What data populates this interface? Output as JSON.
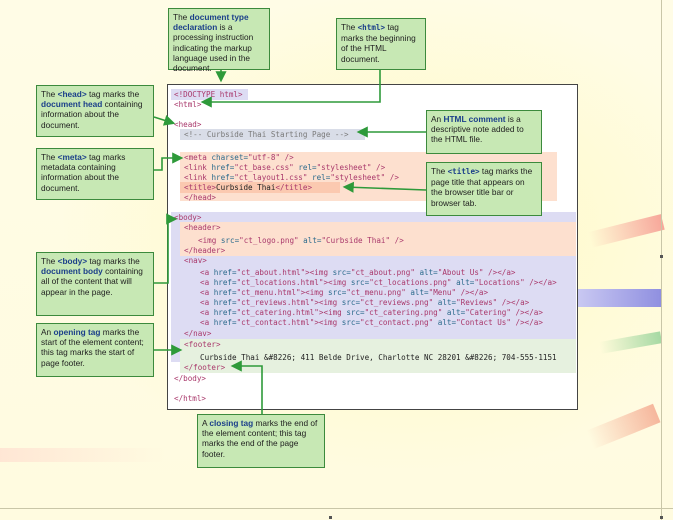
{
  "code_lines": [
    {
      "id": "doctype",
      "segments": [
        {
          "t": "<!DOCTYPE html>",
          "c": "tagc"
        }
      ]
    },
    {
      "id": "html_open",
      "segments": [
        {
          "t": "<html>",
          "c": "tagc"
        }
      ]
    },
    {
      "id": "head_open",
      "segments": [
        {
          "t": "<head>",
          "c": "tagc"
        }
      ]
    },
    {
      "id": "comment",
      "segments": [
        {
          "t": "<!-- Curbside Thai Starting Page -->",
          "c": "cmt"
        }
      ]
    },
    {
      "id": "meta",
      "segments": [
        {
          "t": "<meta ",
          "c": "tagc"
        },
        {
          "t": "charset=",
          "c": "attr"
        },
        {
          "t": "\"utf-8\"",
          "c": "val"
        },
        {
          "t": " />",
          "c": "tagc"
        }
      ]
    },
    {
      "id": "link1",
      "segments": [
        {
          "t": "<link ",
          "c": "tagc"
        },
        {
          "t": "href=",
          "c": "attr"
        },
        {
          "t": "\"ct_base.css\" ",
          "c": "val"
        },
        {
          "t": "rel=",
          "c": "attr"
        },
        {
          "t": "\"stylesheet\"",
          "c": "val"
        },
        {
          "t": " />",
          "c": "tagc"
        }
      ]
    },
    {
      "id": "link2",
      "segments": [
        {
          "t": "<link ",
          "c": "tagc"
        },
        {
          "t": "href=",
          "c": "attr"
        },
        {
          "t": "\"ct_layout1.css\" ",
          "c": "val"
        },
        {
          "t": "rel=",
          "c": "attr"
        },
        {
          "t": "\"stylesheet\"",
          "c": "val"
        },
        {
          "t": " />",
          "c": "tagc"
        }
      ]
    },
    {
      "id": "title",
      "segments": [
        {
          "t": "<title>",
          "c": "tagc"
        },
        {
          "t": "Curbside Thai",
          "c": ""
        },
        {
          "t": "</title>",
          "c": "tagc"
        }
      ]
    },
    {
      "id": "head_close",
      "segments": [
        {
          "t": "</head>",
          "c": "tagc"
        }
      ]
    },
    {
      "id": "body_open",
      "segments": [
        {
          "t": "<body>",
          "c": "tagc"
        }
      ]
    },
    {
      "id": "header_open",
      "segments": [
        {
          "t": "<header>",
          "c": "tagc"
        }
      ]
    },
    {
      "id": "img",
      "segments": [
        {
          "t": "<img ",
          "c": "tagc"
        },
        {
          "t": "src=",
          "c": "attr"
        },
        {
          "t": "\"ct_logo.png\" ",
          "c": "val"
        },
        {
          "t": "alt=",
          "c": "attr"
        },
        {
          "t": "\"Curbside Thai\"",
          "c": "val"
        },
        {
          "t": " />",
          "c": "tagc"
        }
      ]
    },
    {
      "id": "header_close",
      "segments": [
        {
          "t": "</header>",
          "c": "tagc"
        }
      ]
    },
    {
      "id": "nav_open",
      "segments": [
        {
          "t": "<nav>",
          "c": "tagc"
        }
      ]
    },
    {
      "id": "nav1",
      "segments": [
        {
          "t": "<a ",
          "c": "tagc"
        },
        {
          "t": "href=",
          "c": "attr"
        },
        {
          "t": "\"ct_about.html\"",
          "c": "val"
        },
        {
          "t": "><img ",
          "c": "tagc"
        },
        {
          "t": "src=",
          "c": "attr"
        },
        {
          "t": "\"ct_about.png\" ",
          "c": "val"
        },
        {
          "t": "alt=",
          "c": "attr"
        },
        {
          "t": "\"About Us\"",
          "c": "val"
        },
        {
          "t": " /></a>",
          "c": "tagc"
        }
      ]
    },
    {
      "id": "nav2",
      "segments": [
        {
          "t": "<a ",
          "c": "tagc"
        },
        {
          "t": "href=",
          "c": "attr"
        },
        {
          "t": "\"ct_locations.html\"",
          "c": "val"
        },
        {
          "t": "><img ",
          "c": "tagc"
        },
        {
          "t": "src=",
          "c": "attr"
        },
        {
          "t": "\"ct_locations.png\" ",
          "c": "val"
        },
        {
          "t": "alt=",
          "c": "attr"
        },
        {
          "t": "\"Locations\"",
          "c": "val"
        },
        {
          "t": " /></a>",
          "c": "tagc"
        }
      ]
    },
    {
      "id": "nav3",
      "segments": [
        {
          "t": "<a ",
          "c": "tagc"
        },
        {
          "t": "href=",
          "c": "attr"
        },
        {
          "t": "\"ct_menu.html\"",
          "c": "val"
        },
        {
          "t": "><img ",
          "c": "tagc"
        },
        {
          "t": "src=",
          "c": "attr"
        },
        {
          "t": "\"ct_menu.png\" ",
          "c": "val"
        },
        {
          "t": "alt=",
          "c": "attr"
        },
        {
          "t": "\"Menu\"",
          "c": "val"
        },
        {
          "t": " /></a>",
          "c": "tagc"
        }
      ]
    },
    {
      "id": "nav4",
      "segments": [
        {
          "t": "<a ",
          "c": "tagc"
        },
        {
          "t": "href=",
          "c": "attr"
        },
        {
          "t": "\"ct_reviews.html\"",
          "c": "val"
        },
        {
          "t": "><img ",
          "c": "tagc"
        },
        {
          "t": "src=",
          "c": "attr"
        },
        {
          "t": "\"ct_reviews.png\" ",
          "c": "val"
        },
        {
          "t": "alt=",
          "c": "attr"
        },
        {
          "t": "\"Reviews\"",
          "c": "val"
        },
        {
          "t": " /></a>",
          "c": "tagc"
        }
      ]
    },
    {
      "id": "nav5",
      "segments": [
        {
          "t": "<a ",
          "c": "tagc"
        },
        {
          "t": "href=",
          "c": "attr"
        },
        {
          "t": "\"ct_catering.html\"",
          "c": "val"
        },
        {
          "t": "><img ",
          "c": "tagc"
        },
        {
          "t": "src=",
          "c": "attr"
        },
        {
          "t": "\"ct_catering.png\" ",
          "c": "val"
        },
        {
          "t": "alt=",
          "c": "attr"
        },
        {
          "t": "\"Catering\"",
          "c": "val"
        },
        {
          "t": " /></a>",
          "c": "tagc"
        }
      ]
    },
    {
      "id": "nav6",
      "segments": [
        {
          "t": "<a ",
          "c": "tagc"
        },
        {
          "t": "href=",
          "c": "attr"
        },
        {
          "t": "\"ct_contact.html\"",
          "c": "val"
        },
        {
          "t": "><img ",
          "c": "tagc"
        },
        {
          "t": "src=",
          "c": "attr"
        },
        {
          "t": "\"ct_contact.png\" ",
          "c": "val"
        },
        {
          "t": "alt=",
          "c": "attr"
        },
        {
          "t": "\"Contact Us\"",
          "c": "val"
        },
        {
          "t": " /></a>",
          "c": "tagc"
        }
      ]
    },
    {
      "id": "nav_close",
      "segments": [
        {
          "t": "</nav>",
          "c": "tagc"
        }
      ]
    },
    {
      "id": "footer_open",
      "segments": [
        {
          "t": "<footer>",
          "c": "tagc"
        }
      ]
    },
    {
      "id": "footer_text",
      "segments": [
        {
          "t": "Curbside Thai &#8226; 411 Belde Drive, Charlotte NC 28201 &#8226; 704-555-1151",
          "c": ""
        }
      ]
    },
    {
      "id": "footer_close",
      "segments": [
        {
          "t": "</footer>",
          "c": "tagc"
        }
      ]
    },
    {
      "id": "body_close",
      "segments": [
        {
          "t": "</body>",
          "c": "tagc"
        }
      ]
    },
    {
      "id": "html_close",
      "segments": [
        {
          "t": "</html>",
          "c": "tagc"
        }
      ]
    }
  ],
  "callouts": {
    "doctype": [
      {
        "t": "The "
      },
      {
        "t": "document type declaration",
        "k": 1
      },
      {
        "t": " is a processing instruction indicating the markup language used in the document."
      }
    ],
    "html": [
      {
        "t": "The "
      },
      {
        "t": "<html>",
        "m": 1
      },
      {
        "t": " tag marks the beginning of the HTML document."
      }
    ],
    "head": [
      {
        "t": "The "
      },
      {
        "t": "<head>",
        "k": 1
      },
      {
        "t": " tag marks the "
      },
      {
        "t": "document head",
        "k": 1
      },
      {
        "t": " containing information about the document."
      }
    ],
    "meta": [
      {
        "t": "The "
      },
      {
        "t": "<meta>",
        "k": 1
      },
      {
        "t": " tag marks metadata containing information about the document."
      }
    ],
    "comment": [
      {
        "t": "An "
      },
      {
        "t": "HTML comment",
        "k": 1
      },
      {
        "t": " is a descriptive note added to the HTML file."
      }
    ],
    "title": [
      {
        "t": "The "
      },
      {
        "t": "<title>",
        "m": 1
      },
      {
        "t": " tag marks the page title that appears on the browser title bar or browser tab."
      }
    ],
    "body": [
      {
        "t": "The "
      },
      {
        "t": "<body>",
        "k": 1
      },
      {
        "t": " tag marks the "
      },
      {
        "t": "document body",
        "k": 1
      },
      {
        "t": " containing all of the content that will appear in the page."
      }
    ],
    "opening": [
      {
        "t": "An "
      },
      {
        "t": "opening tag",
        "k": 1
      },
      {
        "t": " marks the start of the element content; this tag marks the start of page footer."
      }
    ],
    "closing": [
      {
        "t": "A "
      },
      {
        "t": "closing tag",
        "k": 1
      },
      {
        "t": " marks the end of the element content; this tag marks the end of the page footer."
      }
    ]
  },
  "colors": {
    "callout_bg": "#c7e8b4",
    "callout_border": "#3c8a3c",
    "arrow": "#2e9a3a",
    "keyword": "#1b3f8a",
    "highlight_head": "#fde0cf",
    "highlight_body": "#dddcf3",
    "highlight_comment": "#d9dde8",
    "highlight_footer": "#e6f1df"
  }
}
